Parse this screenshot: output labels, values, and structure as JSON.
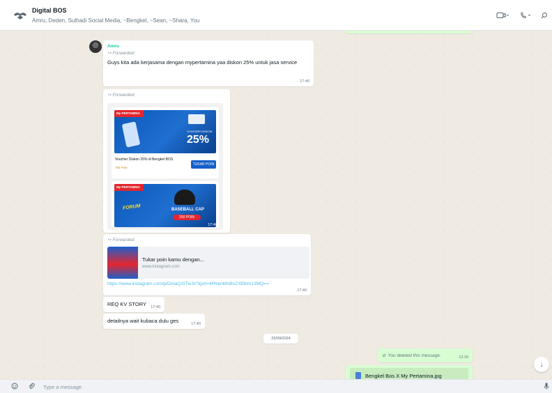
{
  "header": {
    "group_name": "Digital BOS",
    "members": "Amru, Deden, Sulhadi Social Media, ~Bengkel, ~Sean, ~Shara, You",
    "icons": {
      "avatar": "group-avatar-icon",
      "video": "video-icon",
      "call": "phone-icon",
      "search": "search-icon"
    }
  },
  "messages": {
    "m1": {
      "sender": "Amru",
      "forwarded": "Forwarded",
      "text": "Guys kita ada kerjasama dengan mypertamina yaa diskon 25% untuk jasa service",
      "time": "17:40"
    },
    "m2": {
      "forwarded": "Forwarded",
      "image": {
        "brand": "My PERTAMINA",
        "voucher_heading": "VOUCHER DISKON",
        "voucher_pct": "25%",
        "voucher_title": "Voucher Diskon 25% di Bengkel BOS",
        "points": "750 Poin",
        "button": "TUKAR POIN",
        "cap_label": "BASEBALL CAP",
        "cap_points": "250 POIN",
        "forum_label": "FORUM"
      },
      "time": "17:40"
    },
    "m3": {
      "forwarded": "Forwarded",
      "link_title": "Tukar poin kamu dengan...",
      "link_domain": "www.instagram.com",
      "url": "https://www.instagram.com/p/DAlaQXITwJt/?igsh=MWpnMnBnZXl5bm13MQ==",
      "time": "17:40"
    },
    "m4": {
      "text": "REQ KV STORY",
      "time": "17:40"
    },
    "m5": {
      "text": "detailnya wait kubaca dulu ges",
      "time": "17:40"
    },
    "date_separator": "23/09/2024",
    "m6": {
      "text": "You deleted this message.",
      "time": "13:18"
    },
    "m7": {
      "filename": "Bengkel Bos X  My Pertamina.jpg"
    }
  },
  "footer": {
    "placeholder": "Type a message",
    "icons": {
      "emoji": "emoji-icon",
      "attach": "paperclip-icon",
      "mic": "microphone-icon"
    }
  },
  "colors": {
    "incoming": "#ffffff",
    "outgoing": "#d9fdd3",
    "chat_bg": "#efeae2",
    "sender_name": "#06cf9c",
    "link": "#53bdeb"
  }
}
